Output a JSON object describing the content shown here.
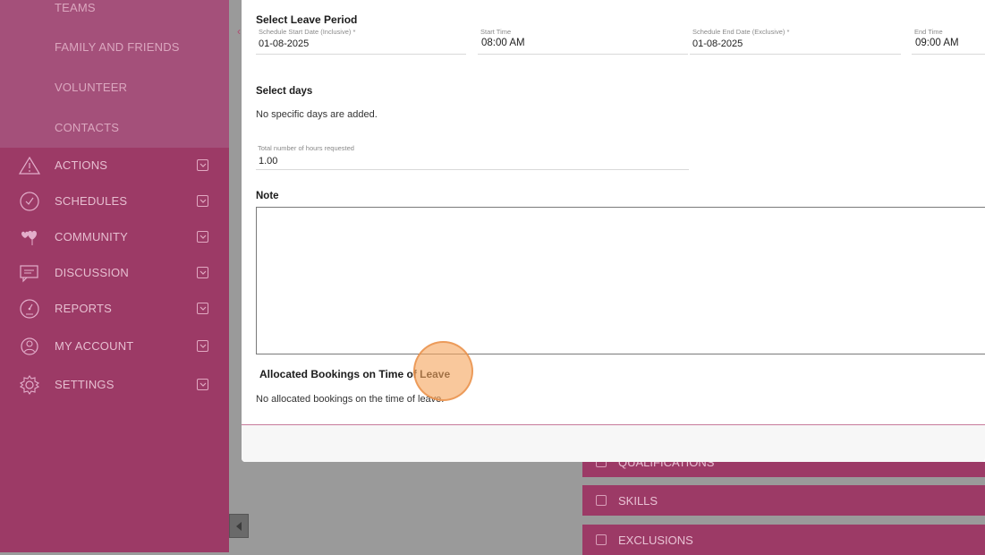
{
  "sidebar": {
    "sub_items": [
      "TEAMS",
      "FAMILY AND FRIENDS",
      "VOLUNTEER",
      "CONTACTS"
    ],
    "items": [
      {
        "label": "ACTIONS",
        "icon": "warning-icon"
      },
      {
        "label": "SCHEDULES",
        "icon": "clock-icon"
      },
      {
        "label": "COMMUNITY",
        "icon": "community-hearts-icon"
      },
      {
        "label": "DISCUSSION",
        "icon": "chat-icon"
      },
      {
        "label": "REPORTS",
        "icon": "dashboard-gauge-icon"
      },
      {
        "label": "MY ACCOUNT",
        "icon": "user-icon"
      },
      {
        "label": "SETTINGS",
        "icon": "gear-icon"
      }
    ]
  },
  "background_sections": [
    "QUALIFICATIONS",
    "SKILLS",
    "EXCLUSIONS"
  ],
  "modal": {
    "leave_period_title": "Select Leave Period",
    "start_date_label": "Schedule Start Date (Inclusive) *",
    "start_date_value": "01-08-2025",
    "start_time_label": "Start Time",
    "start_time_value": "08:00 AM",
    "end_date_label": "Schedule End Date (Exclusive) *",
    "end_date_value": "01-08-2025",
    "end_time_label": "End Time",
    "end_time_value": "09:00 AM",
    "select_days_title": "Select days",
    "no_days_text": "No specific days are added.",
    "hours_label": "Total number of hours requested",
    "hours_value": "1.00",
    "note_title": "Note",
    "note_value": "",
    "bookings_title": "Allocated Bookings on Time of Leave",
    "bookings_text": "No allocated bookings on the time of leave."
  },
  "colors": {
    "sidebar": "#9c3a66",
    "sidebar_sub": "#a4507a",
    "cursor_highlight": "#f5a660"
  }
}
